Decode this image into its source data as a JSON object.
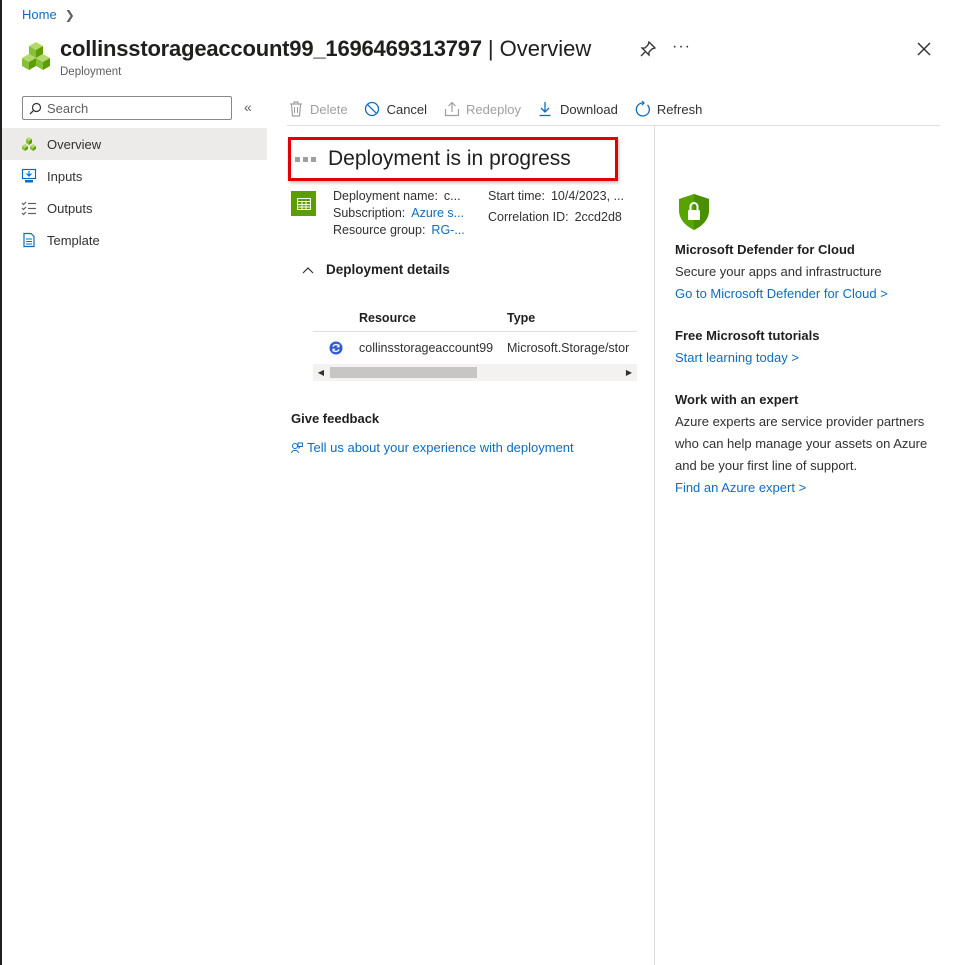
{
  "breadcrumb": {
    "home": "Home"
  },
  "header": {
    "resource_name": "collinsstorageaccount99_1696469313797",
    "separator": "|",
    "section": "Overview",
    "subtitle": "Deployment",
    "more": "···"
  },
  "sidebar": {
    "search_placeholder": "Search",
    "items": [
      {
        "label": "Overview",
        "icon": "deployment-icon",
        "active": true
      },
      {
        "label": "Inputs",
        "icon": "inputs-icon"
      },
      {
        "label": "Outputs",
        "icon": "outputs-icon"
      },
      {
        "label": "Template",
        "icon": "template-icon"
      }
    ]
  },
  "toolbar": {
    "delete": "Delete",
    "cancel": "Cancel",
    "redeploy": "Redeploy",
    "download": "Download",
    "refresh": "Refresh"
  },
  "status": {
    "title": "Deployment is in progress"
  },
  "deployment_info": {
    "name_label": "Deployment name:",
    "name_value": "c...",
    "subscription_label": "Subscription:",
    "subscription_value": "Azure s...",
    "resource_group_label": "Resource group:",
    "resource_group_value": "RG-...",
    "start_time_label": "Start time:",
    "start_time_value": "10/4/2023, ...",
    "correlation_label": "Correlation ID:",
    "correlation_value": "2ccd2d8"
  },
  "details": {
    "title": "Deployment details",
    "columns": [
      "Resource",
      "Type"
    ],
    "rows": [
      {
        "resource": "collinsstorageaccount99",
        "type": "Microsoft.Storage/stor"
      }
    ]
  },
  "feedback": {
    "title": "Give feedback",
    "link": "Tell us about your experience with deployment"
  },
  "right_panel": {
    "defender_title": "Microsoft Defender for Cloud",
    "defender_text": "Secure your apps and infrastructure",
    "defender_link": "Go to Microsoft Defender for Cloud >",
    "tutorials_title": "Free Microsoft tutorials",
    "tutorials_link": "Start learning today >",
    "expert_title": "Work with an expert",
    "expert_line1": "Azure experts are service provider partners",
    "expert_line2": "who can help manage your assets on Azure",
    "expert_line3": "and be your first line of support.",
    "expert_link": "Find an Azure expert >"
  },
  "colors": {
    "accent": "#0f6cbd",
    "status_outline": "#e00000",
    "deployment_green": "#5c9d00",
    "shield_green": "#57a300"
  }
}
